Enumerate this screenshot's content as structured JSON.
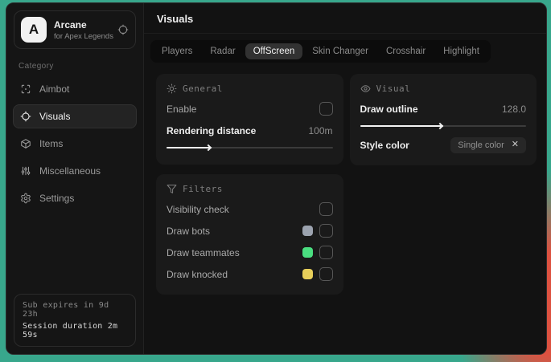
{
  "app": {
    "logo_letter": "A",
    "name": "Arcane",
    "subtitle": "for Apex Legends"
  },
  "sidebar": {
    "category_label": "Category",
    "items": [
      {
        "label": "Aimbot",
        "selected": false
      },
      {
        "label": "Visuals",
        "selected": true
      },
      {
        "label": "Items",
        "selected": false
      },
      {
        "label": "Miscellaneous",
        "selected": false
      },
      {
        "label": "Settings",
        "selected": false
      }
    ],
    "footer": {
      "sub_expires": "Sub expires in 9d 23h",
      "session_duration": "Session duration 2m 59s"
    }
  },
  "header": {
    "title": "Visuals"
  },
  "tabs": {
    "items": [
      {
        "label": "Players",
        "selected": false
      },
      {
        "label": "Radar",
        "selected": false
      },
      {
        "label": "OffScreen",
        "selected": true
      },
      {
        "label": "Skin Changer",
        "selected": false
      },
      {
        "label": "Crosshair",
        "selected": false
      },
      {
        "label": "Highlight",
        "selected": false
      }
    ]
  },
  "panels": {
    "general": {
      "title": "General",
      "enable_label": "Enable",
      "enable_checked": false,
      "rendering_label": "Rendering distance",
      "rendering_value": "100m",
      "slider_percent": 27
    },
    "visual": {
      "title": "Visual",
      "outline_label": "Draw outline",
      "outline_value": "128.0",
      "slider_percent": 50,
      "style_label": "Style color",
      "style_value": "Single color",
      "style_clear": "✕"
    },
    "filters": {
      "title": "Filters",
      "rows": [
        {
          "label": "Visibility check",
          "swatch": null,
          "checked": false
        },
        {
          "label": "Draw bots",
          "swatch": "#9ca3af",
          "checked": false
        },
        {
          "label": "Draw teammates",
          "swatch": "#4ade80",
          "checked": false
        },
        {
          "label": "Draw knocked",
          "swatch": "#e8cf5a",
          "checked": false
        }
      ]
    }
  },
  "colors": {
    "backdrop_teal": "#38a78c",
    "backdrop_red": "#dd5140"
  }
}
